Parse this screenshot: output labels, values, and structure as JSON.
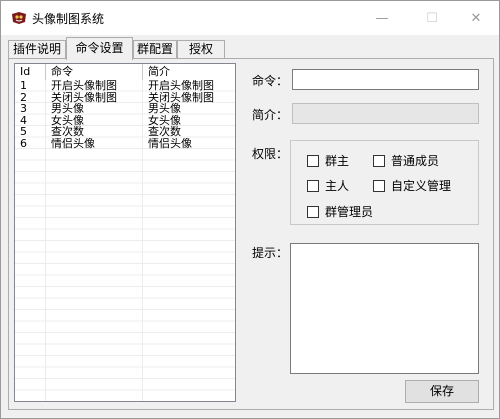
{
  "window": {
    "title": "头像制图系统",
    "controls": {
      "minimize": "—",
      "maximize": "☐",
      "close": "✕"
    }
  },
  "tabs": [
    {
      "label": "插件说明"
    },
    {
      "label": "命令设置",
      "active": true
    },
    {
      "label": "群配置"
    },
    {
      "label": "授权"
    }
  ],
  "table": {
    "columns": [
      "Id",
      "命令",
      "简介"
    ],
    "rows": [
      [
        "1",
        "开启头像制图",
        "开启头像制图"
      ],
      [
        "2",
        "关闭头像制图",
        "关闭头像制图"
      ],
      [
        "3",
        "男头像",
        "男头像"
      ],
      [
        "4",
        "女头像",
        "女头像"
      ],
      [
        "5",
        "查次数",
        "查次数"
      ],
      [
        "6",
        "情侣头像",
        "情侣头像"
      ]
    ]
  },
  "form": {
    "command_label": "命令：",
    "command_value": "",
    "summary_label": "简介：",
    "summary_value": "",
    "permission_label": "权限：",
    "permissions": [
      {
        "label": "群主",
        "checked": false
      },
      {
        "label": "普通成员",
        "checked": false
      },
      {
        "label": "主人",
        "checked": false
      },
      {
        "label": "自定义管理",
        "checked": false
      },
      {
        "label": "群管理员",
        "checked": false
      }
    ],
    "hint_label": "提示：",
    "hint_value": "",
    "save_label": "保存"
  }
}
